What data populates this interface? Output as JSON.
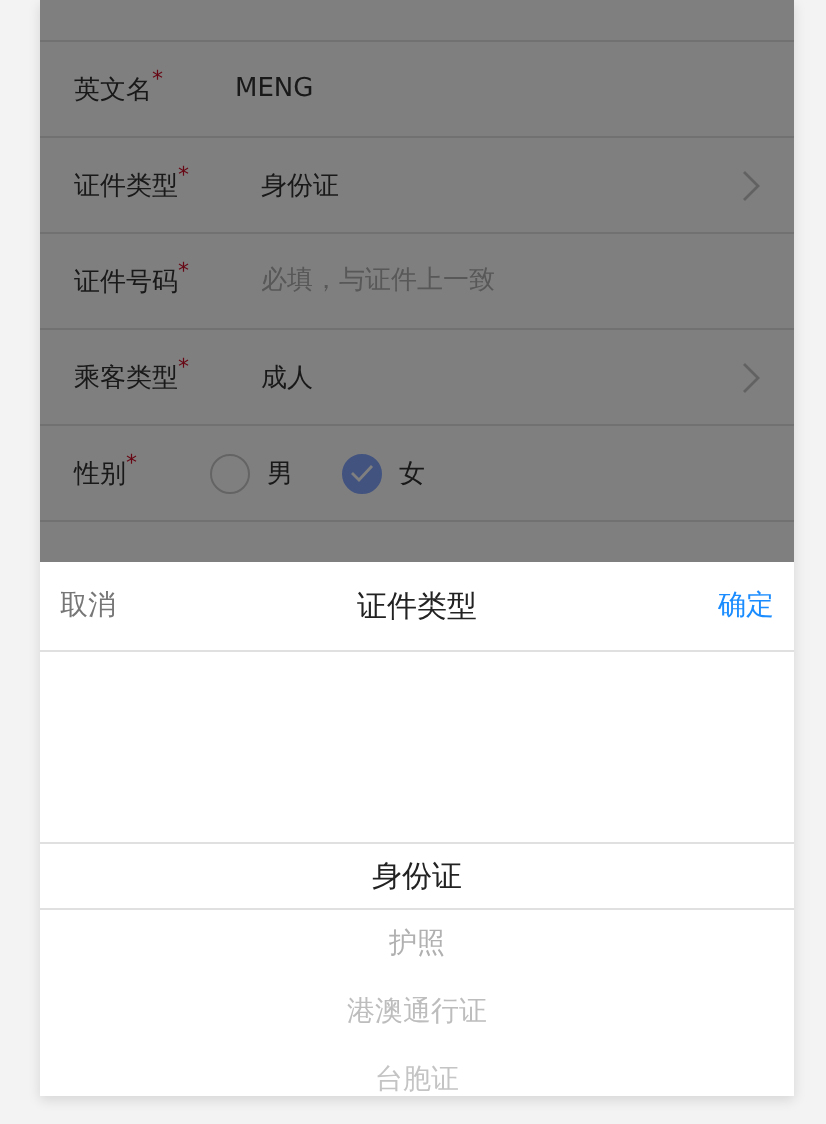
{
  "form": {
    "rows": [
      {
        "label": "英文名",
        "required_mark": "*",
        "kind": "text",
        "value": "MENG"
      },
      {
        "label": "证件类型",
        "required_mark": "*",
        "kind": "select",
        "value": "身份证"
      },
      {
        "label": "证件号码",
        "required_mark": "*",
        "kind": "text",
        "placeholder": "必填，与证件上一致"
      },
      {
        "label": "乘客类型",
        "required_mark": "*",
        "kind": "select",
        "value": "成人"
      },
      {
        "label": "性别",
        "required_mark": "*",
        "kind": "radio",
        "options": [
          {
            "label": "男",
            "selected": false
          },
          {
            "label": "女",
            "selected": true
          }
        ]
      }
    ]
  },
  "picker": {
    "cancel": "取消",
    "title": "证件类型",
    "confirm": "确定",
    "options": [
      {
        "label": "身份证",
        "selected": true
      },
      {
        "label": "护照",
        "selected": false
      },
      {
        "label": "港澳通行证",
        "selected": false
      },
      {
        "label": "台胞证",
        "selected": false
      }
    ]
  }
}
